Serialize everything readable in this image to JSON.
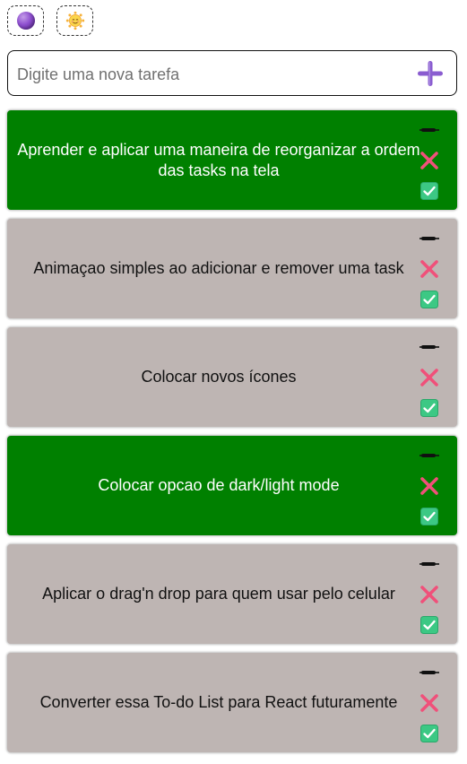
{
  "theme": {
    "dark_icon": "purple-planet-icon",
    "light_icon": "sun-face-icon"
  },
  "new_task": {
    "placeholder": "Digite uma nova tarefa",
    "value": "",
    "add_icon": "plus-icon"
  },
  "colors": {
    "done": "#008000",
    "pending": "#beb5b3",
    "delete": "#f0507a",
    "check": "#3cc884",
    "plus": "#8a5cd0"
  },
  "tasks": [
    {
      "text": "Aprender e aplicar uma maneira de reorganizar a ordem das tasks na tela",
      "done": true
    },
    {
      "text": "Animaçao simples ao adicionar e remover uma task",
      "done": false
    },
    {
      "text": "Colocar novos ícones",
      "done": false
    },
    {
      "text": "Colocar opcao de dark/light mode",
      "done": true
    },
    {
      "text": "Aplicar o drag'n drop para quem usar pelo celular",
      "done": false
    },
    {
      "text": "Converter essa To-do List para React futuramente",
      "done": false
    }
  ]
}
